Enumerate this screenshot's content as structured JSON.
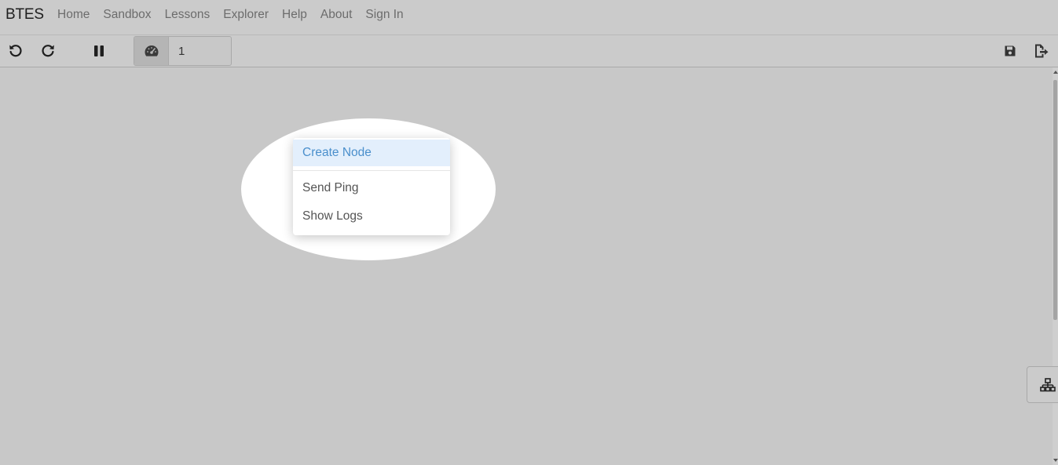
{
  "navbar": {
    "brand": "BTES",
    "links": [
      {
        "label": "Home"
      },
      {
        "label": "Sandbox"
      },
      {
        "label": "Lessons"
      },
      {
        "label": "Explorer"
      },
      {
        "label": "Help"
      },
      {
        "label": "About"
      },
      {
        "label": "Sign In"
      }
    ]
  },
  "toolbar": {
    "undo_icon": "undo-icon",
    "redo_icon": "redo-icon",
    "pause_icon": "pause-icon",
    "speed_icon": "speedometer-icon",
    "speed_value": "1",
    "save_icon": "save-icon",
    "export_icon": "export-icon"
  },
  "context_menu": {
    "items": [
      {
        "label": "Create Node",
        "highlighted": true
      },
      {
        "label": "Send Ping",
        "highlighted": false
      },
      {
        "label": "Show Logs",
        "highlighted": false
      }
    ]
  },
  "side_panel": {
    "icon": "network-topology-icon"
  },
  "colors": {
    "background": "#c8c8c8",
    "menu_highlight_bg": "#e3effc",
    "menu_highlight_text": "#4a8fcc",
    "nav_text": "#6c6c6c"
  }
}
